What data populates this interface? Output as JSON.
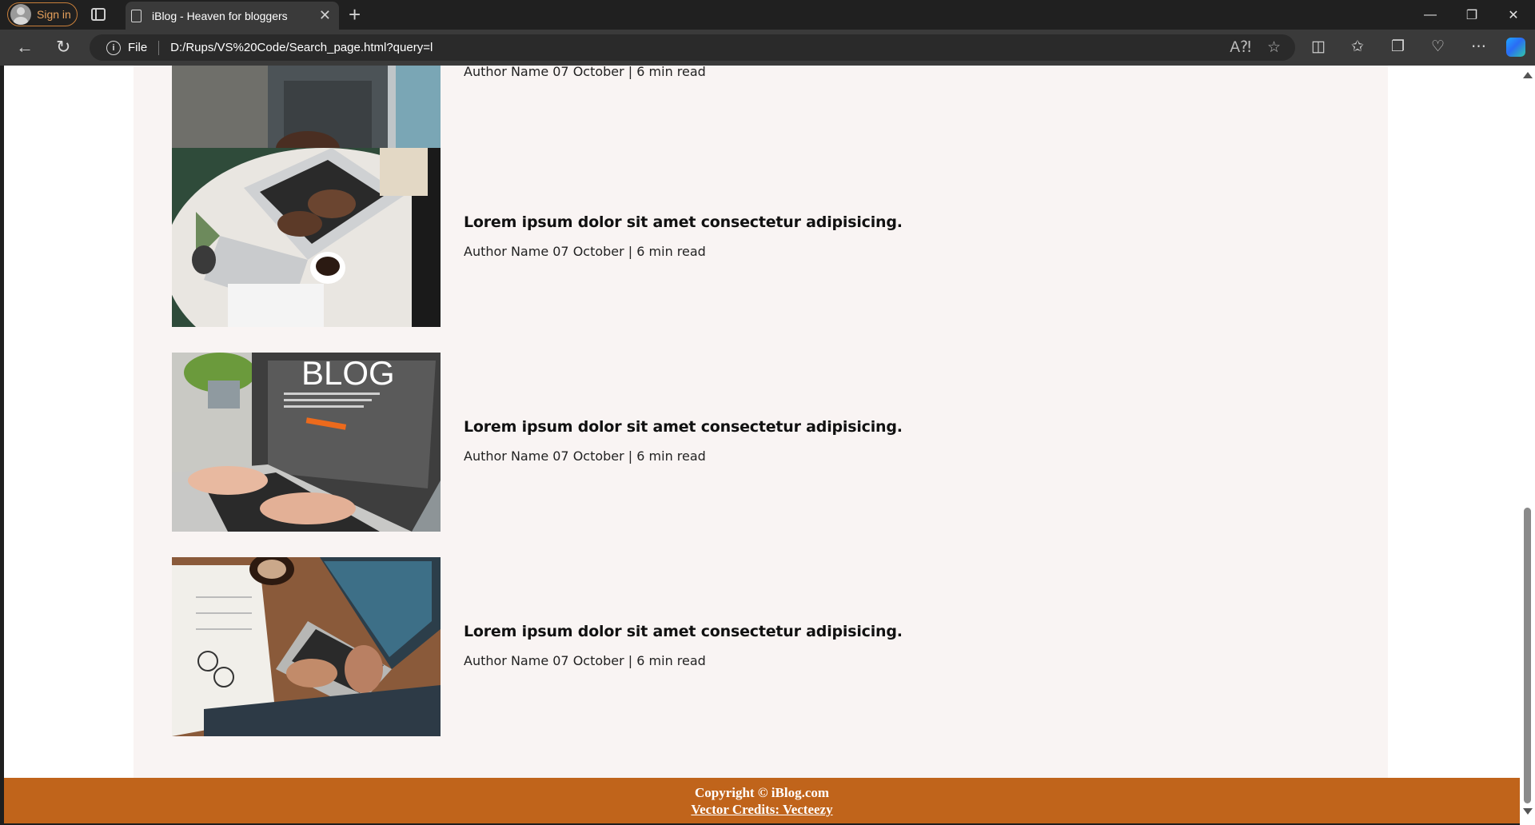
{
  "browser": {
    "signin_label": "Sign in",
    "tab_title": "iBlog - Heaven for bloggers",
    "tab_close": "✕",
    "new_tab": "+",
    "address_scheme_label": "File",
    "address_url": "D:/Rups/VS%20Code/Search_page.html?query=l",
    "window_controls": {
      "minimize": "—",
      "restore": "❐",
      "close": "✕"
    }
  },
  "posts": [
    {
      "title": "",
      "meta": "Author Name 07 October | 6 min read",
      "image": "laptop-typing-photo"
    },
    {
      "title": "Lorem ipsum dolor sit amet consectetur adipisicing.",
      "meta": "Author Name 07 October | 6 min read",
      "image": "laptop-coffee-photo"
    },
    {
      "title": "Lorem ipsum dolor sit amet consectetur adipisicing.",
      "meta": "Author Name 07 October | 6 min read",
      "image": "blog-laptop-photo",
      "image_text": "BLOG"
    },
    {
      "title": "Lorem ipsum dolor sit amet consectetur adipisicing.",
      "meta": "Author Name 07 October | 6 min read",
      "image": "desk-notebook-photo"
    }
  ],
  "footer": {
    "copyright": "Copyright © iBlog.com",
    "credits": "Vector Credits: Vecteezy"
  },
  "colors": {
    "footer_bg": "#c0641b",
    "content_bg": "#f9f4f3",
    "signin_accent": "#e7a15c"
  }
}
